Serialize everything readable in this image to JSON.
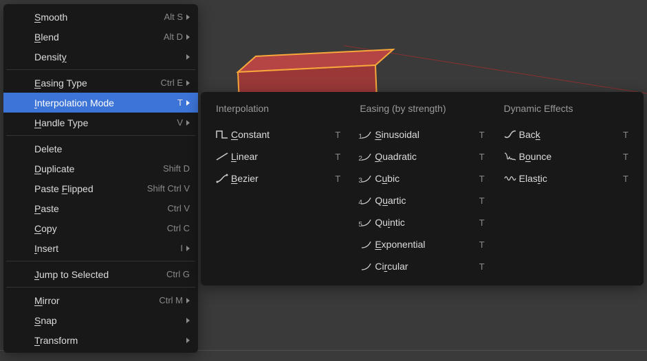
{
  "menu": {
    "groups": [
      [
        {
          "label": "Smooth",
          "ul": 0,
          "shortcut": "Alt S",
          "arrow": true
        },
        {
          "label": "Blend",
          "ul": 0,
          "shortcut": "Alt D",
          "arrow": true
        },
        {
          "label": "Density",
          "ul": 6,
          "shortcut": "",
          "arrow": true
        }
      ],
      [
        {
          "label": "Easing Type",
          "ul": 0,
          "shortcut": "Ctrl E",
          "arrow": true
        },
        {
          "label": "Interpolation Mode",
          "ul": 0,
          "shortcut": "T",
          "arrow": true,
          "active": true
        },
        {
          "label": "Handle Type",
          "ul": 0,
          "shortcut": "V",
          "arrow": true
        }
      ],
      [
        {
          "label": "Delete",
          "ul": -1,
          "shortcut": "",
          "arrow": false
        },
        {
          "label": "Duplicate",
          "ul": 0,
          "shortcut": "Shift D",
          "arrow": false
        },
        {
          "label": "Paste Flipped",
          "ul": 6,
          "shortcut": "Shift Ctrl V",
          "arrow": false
        },
        {
          "label": "Paste",
          "ul": 0,
          "shortcut": "Ctrl V",
          "arrow": false
        },
        {
          "label": "Copy",
          "ul": 0,
          "shortcut": "Ctrl C",
          "arrow": false
        },
        {
          "label": "Insert",
          "ul": 0,
          "shortcut": "I",
          "arrow": true
        }
      ],
      [
        {
          "label": "Jump to Selected",
          "ul": 0,
          "shortcut": "Ctrl G",
          "arrow": false
        }
      ],
      [
        {
          "label": "Mirror",
          "ul": 0,
          "shortcut": "Ctrl M",
          "arrow": true
        },
        {
          "label": "Snap",
          "ul": 0,
          "shortcut": "",
          "arrow": true
        },
        {
          "label": "Transform",
          "ul": 0,
          "shortcut": "",
          "arrow": true
        }
      ]
    ]
  },
  "submenu": {
    "cols": [
      {
        "header": "Interpolation",
        "items": [
          {
            "icon": "constant",
            "label": "Constant",
            "ul": 0,
            "shortcut": "T"
          },
          {
            "icon": "linear",
            "label": "Linear",
            "ul": 0,
            "shortcut": "T"
          },
          {
            "icon": "bezier",
            "label": "Bezier",
            "ul": 0,
            "shortcut": "T"
          }
        ]
      },
      {
        "header": "Easing (by strength)",
        "items": [
          {
            "num": "1",
            "label": "Sinusoidal",
            "ul": 0,
            "shortcut": "T"
          },
          {
            "num": "2",
            "label": "Quadratic",
            "ul": 0,
            "shortcut": "T"
          },
          {
            "num": "3",
            "label": "Cubic",
            "ul": 1,
            "shortcut": "T"
          },
          {
            "num": "4",
            "label": "Quartic",
            "ul": 1,
            "shortcut": "T"
          },
          {
            "num": "5",
            "label": "Quintic",
            "ul": 2,
            "shortcut": "T"
          },
          {
            "num": "",
            "label": "Exponential",
            "ul": 0,
            "shortcut": "T"
          },
          {
            "num": "",
            "label": "Circular",
            "ul": 2,
            "shortcut": "T"
          }
        ]
      },
      {
        "header": "Dynamic Effects",
        "items": [
          {
            "icon": "back",
            "label": "Back",
            "ul": 3,
            "shortcut": "T"
          },
          {
            "icon": "bounce",
            "label": "Bounce",
            "ul": 1,
            "shortcut": "T"
          },
          {
            "icon": "elastic",
            "label": "Elastic",
            "ul": 4,
            "shortcut": "T"
          }
        ]
      }
    ]
  }
}
